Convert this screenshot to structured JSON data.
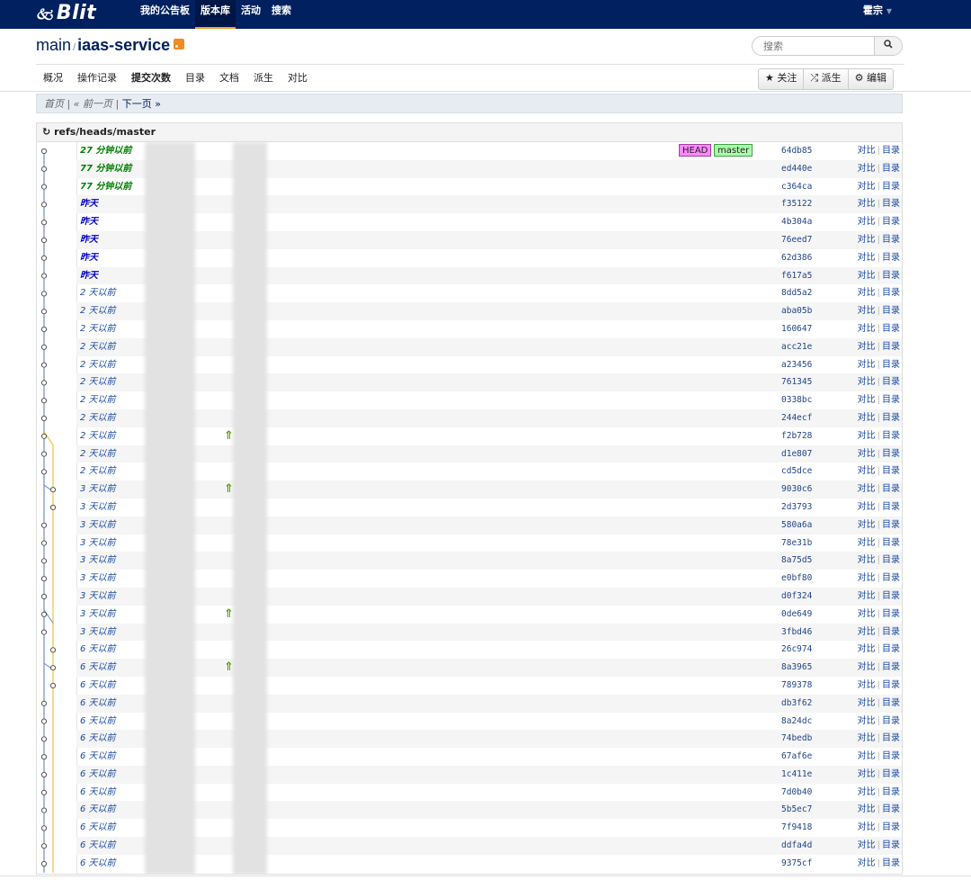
{
  "brand": "Blit",
  "brand_glyph": "🙵",
  "nav": [
    "我的公告板",
    "版本库",
    "活动",
    "搜索"
  ],
  "user": "霍宗",
  "repo": {
    "group": "main",
    "name": "iaas-service"
  },
  "search": {
    "placeholder": "搜索",
    "button_icon": "search-icon"
  },
  "subnav": [
    "概况",
    "操作记录",
    "提交次数",
    "目录",
    "文档",
    "派生",
    "对比"
  ],
  "actions": [
    "★ 关注",
    "⤮ 派生",
    "⚙ 编辑"
  ],
  "pager": {
    "first": "首页",
    "prev": "« 前一页",
    "next": "下一页 »"
  },
  "ref": "refs/heads/master",
  "tags": {
    "head": "HEAD",
    "branch": "master"
  },
  "link_compare": "对比",
  "link_tree": "目录",
  "commits": [
    {
      "date": "27 分钟以前",
      "style": "green",
      "hash": "64db85"
    },
    {
      "date": "77 分钟以前",
      "style": "green",
      "hash": "ed440e"
    },
    {
      "date": "77 分钟以前",
      "style": "green",
      "hash": "c364ca"
    },
    {
      "date": "昨天",
      "style": "blue",
      "hash": "f35122"
    },
    {
      "date": "昨天",
      "style": "blue",
      "hash": "4b304a"
    },
    {
      "date": "昨天",
      "style": "blue",
      "hash": "76eed7"
    },
    {
      "date": "昨天",
      "style": "blue",
      "hash": "62d386"
    },
    {
      "date": "昨天",
      "style": "blue",
      "hash": "f617a5"
    },
    {
      "date": "2 天以前",
      "style": "norm",
      "hash": "8dd5a2"
    },
    {
      "date": "2 天以前",
      "style": "norm",
      "hash": "aba05b"
    },
    {
      "date": "2 天以前",
      "style": "norm",
      "hash": "160647"
    },
    {
      "date": "2 天以前",
      "style": "norm",
      "hash": "acc21e"
    },
    {
      "date": "2 天以前",
      "style": "norm",
      "hash": "a23456"
    },
    {
      "date": "2 天以前",
      "style": "norm",
      "hash": "761345"
    },
    {
      "date": "2 天以前",
      "style": "norm",
      "hash": "0338bc"
    },
    {
      "date": "2 天以前",
      "style": "norm",
      "hash": "244ecf"
    },
    {
      "date": "2 天以前",
      "style": "norm",
      "hash": "f2b728"
    },
    {
      "date": "2 天以前",
      "style": "norm",
      "hash": "d1e807"
    },
    {
      "date": "2 天以前",
      "style": "norm",
      "hash": "cd5dce"
    },
    {
      "date": "3 天以前",
      "style": "norm",
      "hash": "9030c6"
    },
    {
      "date": "3 天以前",
      "style": "norm",
      "hash": "2d3793"
    },
    {
      "date": "3 天以前",
      "style": "norm",
      "hash": "580a6a"
    },
    {
      "date": "3 天以前",
      "style": "norm",
      "hash": "78e31b"
    },
    {
      "date": "3 天以前",
      "style": "norm",
      "hash": "8a75d5"
    },
    {
      "date": "3 天以前",
      "style": "norm",
      "hash": "e0bf80"
    },
    {
      "date": "3 天以前",
      "style": "norm",
      "hash": "d0f324"
    },
    {
      "date": "3 天以前",
      "style": "norm",
      "hash": "0de649"
    },
    {
      "date": "3 天以前",
      "style": "norm",
      "hash": "3fbd46"
    },
    {
      "date": "6 天以前",
      "style": "norm",
      "hash": "26c974"
    },
    {
      "date": "6 天以前",
      "style": "norm",
      "hash": "8a3965"
    },
    {
      "date": "6 天以前",
      "style": "norm",
      "hash": "789378"
    },
    {
      "date": "6 天以前",
      "style": "norm",
      "hash": "db3f62"
    },
    {
      "date": "6 天以前",
      "style": "norm",
      "hash": "8a24dc"
    },
    {
      "date": "6 天以前",
      "style": "norm",
      "hash": "74bedb"
    },
    {
      "date": "6 天以前",
      "style": "norm",
      "hash": "67af6e"
    },
    {
      "date": "6 天以前",
      "style": "norm",
      "hash": "1c411e"
    },
    {
      "date": "6 天以前",
      "style": "norm",
      "hash": "7d0b40"
    },
    {
      "date": "6 天以前",
      "style": "norm",
      "hash": "5b5ec7"
    },
    {
      "date": "6 天以前",
      "style": "norm",
      "hash": "7f9418"
    },
    {
      "date": "6 天以前",
      "style": "norm",
      "hash": "ddfa4d"
    },
    {
      "date": "6 天以前",
      "style": "norm",
      "hash": "9375cf"
    }
  ],
  "merge_rows": [
    16,
    19,
    26,
    29
  ],
  "colors": {
    "navbar": "#002060",
    "accent": "#f0a030",
    "graph_main": "#6a8ec8",
    "graph_branch": "#f0c040"
  }
}
